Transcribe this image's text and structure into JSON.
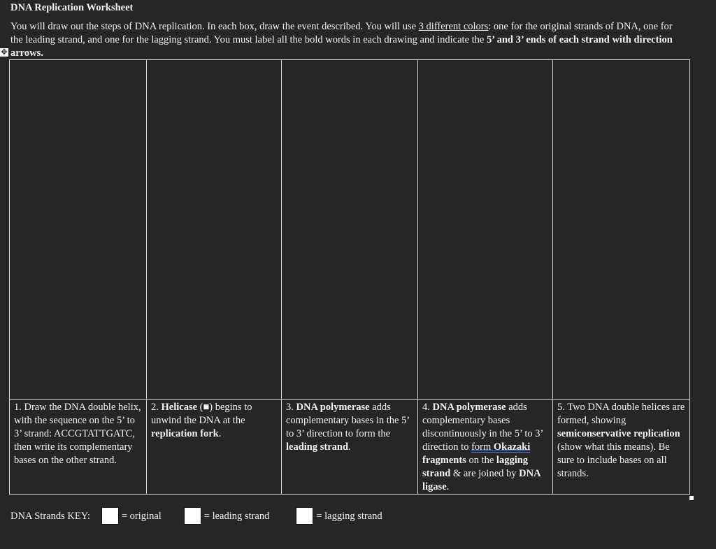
{
  "document": {
    "title": "DNA Replication Worksheet",
    "intro": {
      "part1": "You will draw out the steps of DNA replication.  In each box, draw the event described.  You will use ",
      "underlined": "3 different colors",
      "part2": ": one for the original strands of DNA, one for the leading strand, and one for the lagging strand.  You must label all the bold words in each drawing and indicate the ",
      "bold1": "5’ and 3’ ends of each strand with direction arrows",
      "part3": "."
    },
    "move_handle_icon": "✥"
  },
  "steps": [
    {
      "number": "1.",
      "segments": [
        {
          "t": " Draw the DNA double helix, with the sequence on the 5’ to 3’ strand: ACCGTATTGATC, then write its complementary bases on the other strand.",
          "b": false
        }
      ]
    },
    {
      "number": "2.",
      "segments": [
        {
          "t": " ",
          "b": false
        },
        {
          "t": "Helicase",
          "b": true
        },
        {
          "t": " (■) begins to unwind the DNA at the ",
          "b": false
        },
        {
          "t": "replication fork",
          "b": true
        },
        {
          "t": ".",
          "b": false
        }
      ]
    },
    {
      "number": "3.",
      "segments": [
        {
          "t": " ",
          "b": false
        },
        {
          "t": "DNA polymerase",
          "b": true
        },
        {
          "t": " adds complementary bases in the 5’ to 3’ direction to form the ",
          "b": false
        },
        {
          "t": "leading strand",
          "b": true
        },
        {
          "t": ".",
          "b": false
        }
      ]
    },
    {
      "number": "4.",
      "segments": [
        {
          "t": " ",
          "b": false
        },
        {
          "t": "DNA polymerase",
          "b": true
        },
        {
          "t": " adds complementary bases discontinuously in the 5’ to 3’ direction to ",
          "b": false
        },
        {
          "t": "form ",
          "b": false,
          "u": true
        },
        {
          "t": "Okazaki",
          "b": true,
          "u": true
        },
        {
          "t": " fragments",
          "b": true
        },
        {
          "t": " on the ",
          "b": false
        },
        {
          "t": "lagging strand",
          "b": true
        },
        {
          "t": " & are joined by ",
          "b": false
        },
        {
          "t": "DNA ligase",
          "b": true
        },
        {
          "t": ".",
          "b": false
        }
      ]
    },
    {
      "number": "5.",
      "segments": [
        {
          "t": " Two DNA double helices are formed, showing ",
          "b": false
        },
        {
          "t": "semiconservative replication",
          "b": true
        },
        {
          "t": " (show what this means). Be sure to include bases on all strands.",
          "b": false
        }
      ]
    }
  ],
  "key": {
    "label": "DNA Strands KEY:",
    "items": [
      {
        "label": "= original",
        "color": "#ffffff"
      },
      {
        "label": "= leading strand",
        "color": "#ffffff"
      },
      {
        "label": "= lagging strand",
        "color": "#ffffff"
      }
    ]
  }
}
